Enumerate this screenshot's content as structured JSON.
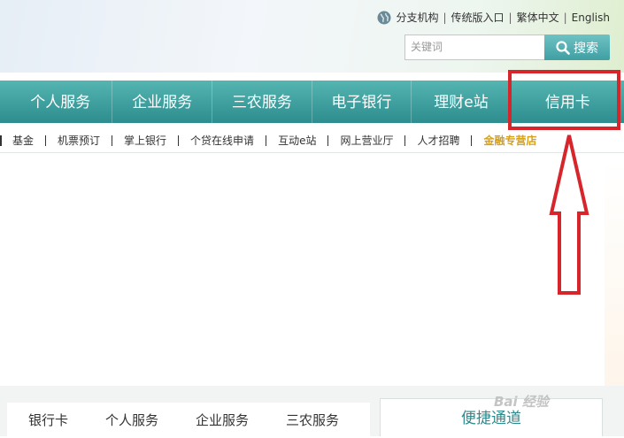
{
  "toplinks": {
    "branch": "分支机构",
    "classic": "传统版入口",
    "traditional": "繁体中文",
    "english": "English",
    "separator": "|"
  },
  "search": {
    "placeholder": "关键词",
    "button_label": "搜索"
  },
  "nav": {
    "items": [
      "个人服务",
      "企业服务",
      "三农服务",
      "电子银行",
      "理财e站",
      "信用卡"
    ]
  },
  "subnav": {
    "items": [
      "基金",
      "机票预订",
      "掌上银行",
      "个贷在线申请",
      "互动e站",
      "网上营业厅",
      "人才招聘",
      "金融专营店"
    ]
  },
  "bottom": {
    "tabs": [
      "银行卡",
      "个人服务",
      "企业服务",
      "三农服务"
    ],
    "quick_access": "便捷通道"
  },
  "watermark": "Bai 经验",
  "colors": {
    "nav_teal": "#3e9f9e",
    "highlight_red": "#d7262b",
    "subnav_gold": "#d5a11a",
    "quick_text": "#2e8a8c"
  }
}
